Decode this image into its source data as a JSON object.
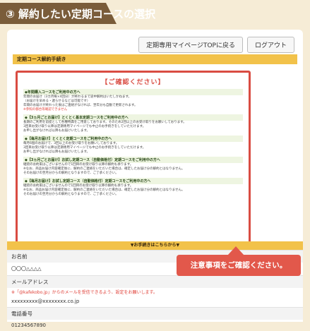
{
  "header": {
    "title": "③ 解約したい定期コースの選択"
  },
  "top_buttons": {
    "mypage": "定期専用マイページTOPに戻る",
    "logout": "ログアウト"
  },
  "section_title": "定期コース解約手続き",
  "notice": {
    "title": "【ご確認ください】",
    "blocks": [
      {
        "head": "◆年間購入コースをご利用中の方へ",
        "lines": [
          "年間のお届け（3カ月毎×4回分）が終わるまで途中解約はいたしかねます。",
          "（お届けを早める・遅らせるなどは可能です）",
          "年間のお届けが終わった後はご連絡がなければ、翌年分も自動で更新されます。"
        ],
        "red": "※参照の都合等確認できません"
      },
      {
        "head": "◆【3ヵ月ごとお届け】とくとく基本定期コースをご利用中の方へ",
        "lines": [
          "長期のご利用を前提として各種特典をご用意しております。そのため2回以上のお受け取りをお願いしております。",
          "3回目お受け取り以降は定期専用マイページでも中止のお手続きをしていただけます。",
          "お申し出がなければ以降もお届けいたします。"
        ]
      },
      {
        "head": "◆【毎月お届け】とくとく定期コースをご利用中の方へ",
        "lines": [
          "毎月6個のお届けで、3回以上のお受け取りをお願いしております。",
          "3回目お受け取り以降は定期専用マイページでも中止のお手続きをしていただけます。",
          "お申し出がなければ以降もお届けいたします。"
        ]
      },
      {
        "head": "◆【3ヵ月ごとお届け】お試し定期コース（自動価格付）定期コースをご利用中の方へ",
        "lines": [
          "継続のお約束はございませんので1回目のお受け取り以降の解約も承ります。",
          "※なお、商品お届け内容確定後に、解約のご連絡をいただいた場合は、確定したお届け分の解約とはなりません。",
          "そのお届けの翌月分からの解約となりますので、ご了承ください。"
        ]
      },
      {
        "head": "◆【毎月お届け】お試し定期コース（自動価格付）定期コースをご利用中の方へ",
        "lines": [
          "継続のお約束はございませんので1回目のお受け取り以降の解約も承ります。",
          "※なお、商品お届け内容確定後に、解約のご連絡をいただいた場合は、確定したお届け分の解約とはなりません。",
          "そのお届けの翌月分からの解約となりますので、ご了承ください。"
        ]
      }
    ]
  },
  "procedure_bar": "▼お手続きはこちらから▼",
  "form": {
    "name_label": "お名前",
    "name_value": "〇〇〇△△△△",
    "email_label": "メールアドレス",
    "email_note": "※「@kafekobo.jp」からのメールを受信できるよう、設定をお願いします。",
    "email_value": "xxxxxxxxx@xxxxxxxx.co.jp",
    "phone_label": "電話番号",
    "phone_value": "01234567890"
  },
  "callout": "注意事項をご確認ください。",
  "colors": {
    "brown": "#7a5c3a",
    "yellow": "#f2c24a",
    "red": "#d94c42"
  }
}
